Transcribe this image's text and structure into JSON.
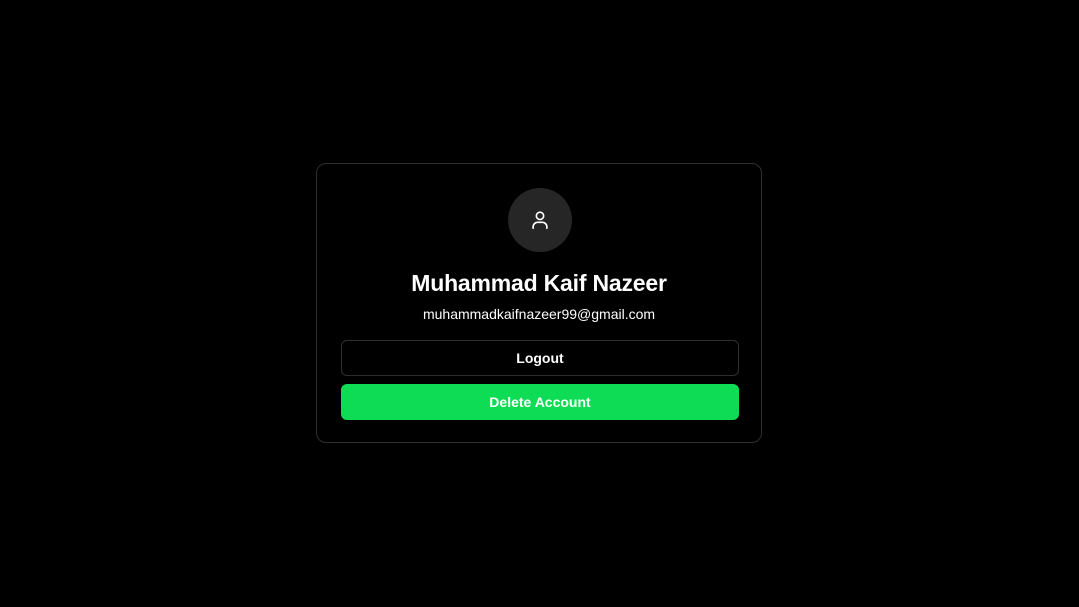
{
  "profile": {
    "name": "Muhammad Kaif Nazeer",
    "email": "muhammadkaifnazeer99@gmail.com",
    "avatar_icon": "user-icon"
  },
  "actions": {
    "logout_label": "Logout",
    "delete_label": "Delete Account"
  },
  "colors": {
    "background": "#000000",
    "card_border": "#2e2e2e",
    "avatar_bg": "#262626",
    "accent_green": "#0fdc55",
    "text": "#ffffff"
  }
}
